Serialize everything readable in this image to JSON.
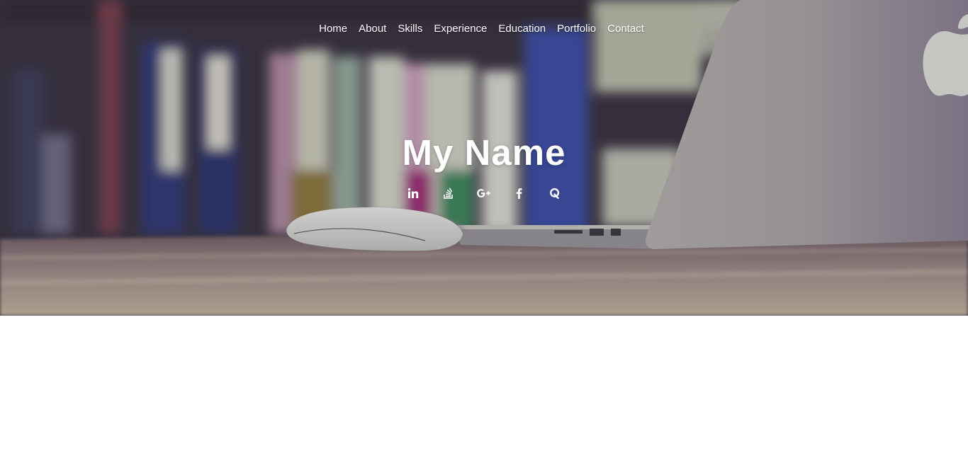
{
  "nav": {
    "items": [
      {
        "label": "Home"
      },
      {
        "label": "About"
      },
      {
        "label": "Skills"
      },
      {
        "label": "Experience"
      },
      {
        "label": "Education"
      },
      {
        "label": "Portfolio"
      },
      {
        "label": "Contact"
      }
    ]
  },
  "hero": {
    "title": "My Name"
  },
  "social": [
    {
      "icon": "linkedin-icon"
    },
    {
      "icon": "stackoverflow-icon"
    },
    {
      "icon": "google-plus-icon"
    },
    {
      "icon": "facebook-icon"
    },
    {
      "icon": "quora-icon"
    }
  ],
  "colors": {
    "nav_text": "#ffffff",
    "title_text": "#ffffff",
    "page_background": "#ffffff"
  }
}
